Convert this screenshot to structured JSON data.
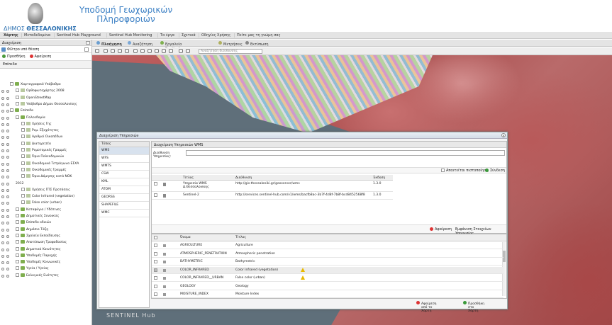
{
  "header": {
    "logo_text_prefix": "ΔΗΜΟΣ ",
    "logo_text_bold": "ΘΕΣΣΑΛΟΝΙΚΗΣ",
    "title_line1": "Υποδομή Γεωχωρικών",
    "title_line2": "Πληροφοριών"
  },
  "menu": [
    "Χάρτης",
    "Μεταδεδομένα",
    "Sentinel Hub Playground",
    "Sentinel Hub Monitoring",
    "Τα έργα",
    "Σχετικά",
    "Οδηγίες Χρήσης",
    "Πείτε μας τη γνώμη σας"
  ],
  "left": {
    "title": "Διαχείριση",
    "search_placeholder": "Φίλτρο υπό θέαση",
    "btn_add": "Προσθήκη",
    "btn_remove": "Αφαίρεση",
    "tab": "Επίπεδα",
    "tree": [
      {
        "label": "Χαρτογραφικό Υπόβαθρο",
        "indent": 1,
        "kind": "folder"
      },
      {
        "label": "Ορθοφωτοχάρτης 2008",
        "indent": 2,
        "kind": "layer"
      },
      {
        "label": "OpenStreetMap",
        "indent": 2,
        "kind": "layer"
      },
      {
        "label": "Υπόβαθρο Δήμου Θεσσαλονίκης",
        "indent": 2,
        "kind": "layer"
      },
      {
        "label": "Επίπεδα",
        "indent": 1,
        "kind": "folder"
      },
      {
        "label": "Πολεοδομία",
        "indent": 2,
        "kind": "folder"
      },
      {
        "label": "Χρήσεις Γης",
        "indent": 3,
        "kind": "layer"
      },
      {
        "label": "Ρυμ. Εξοχότητες",
        "indent": 3,
        "kind": "layer"
      },
      {
        "label": "Αριθμοί Οικοπέδων",
        "indent": 3,
        "kind": "layer"
      },
      {
        "label": "Διατηρητέα",
        "indent": 3,
        "kind": "layer"
      },
      {
        "label": "Ρυμοτομικές Γραμμές",
        "indent": 3,
        "kind": "layer"
      },
      {
        "label": "Όρια Πολεοδομικών",
        "indent": 3,
        "kind": "layer"
      },
      {
        "label": "Οικοδομικά Τετράγωνα ΕΣΧΑ",
        "indent": 3,
        "kind": "layer"
      },
      {
        "label": "Οικοδομικές Γραμμές",
        "indent": 3,
        "kind": "layer"
      },
      {
        "label": "Όρια Δόμησης κατά ΝΟΚ",
        "indent": 3,
        "kind": "layer"
      },
      {
        "label": "2012",
        "indent": 2,
        "kind": "text"
      },
      {
        "label": "Χρήσεις ΓΠΣ Προτάσεις",
        "indent": 3,
        "kind": "layer"
      },
      {
        "label": "Color Infrared (vegetation)",
        "indent": 3,
        "kind": "layer"
      },
      {
        "label": "False color (urban)",
        "indent": 3,
        "kind": "layer"
      },
      {
        "label": "Καταφύγια / Υδάτινες",
        "indent": 2,
        "kind": "folder"
      },
      {
        "label": "Δημοτικές Συνοικίες",
        "indent": 2,
        "kind": "folder"
      },
      {
        "label": "Επίπεδο οδικών",
        "indent": 2,
        "kind": "folder"
      },
      {
        "label": "Δημόσιο Τάξη",
        "indent": 2,
        "kind": "folder"
      },
      {
        "label": "Σχολεία Εκπαίδευσης",
        "indent": 2,
        "kind": "folder"
      },
      {
        "label": "Αποτύπωση Τροφοδοσίας",
        "indent": 2,
        "kind": "folder"
      },
      {
        "label": "Δημοτικά Κοινότητες",
        "indent": 2,
        "kind": "folder"
      },
      {
        "label": "Υποδομές Παροχής",
        "indent": 2,
        "kind": "folder"
      },
      {
        "label": "Υποδομές Κοινωνικές",
        "indent": 2,
        "kind": "folder"
      },
      {
        "label": "Υγεία / Υγείας",
        "indent": 2,
        "kind": "folder"
      },
      {
        "label": "Εκλογικές Ενότητες",
        "indent": 2,
        "kind": "folder"
      }
    ]
  },
  "toolbar": {
    "items": [
      "Πλοήγηση",
      "Αναζήτηση",
      "Εργαλεία Sentinel Hub",
      "Μετρήσεις",
      "Εκτύπωση"
    ],
    "address_placeholder": "Αναζήτηση διεύθυνσης"
  },
  "map": {
    "footer": "SENTINEL Hub"
  },
  "dialog": {
    "title": "Διαχείριση Υπηρεσιών",
    "types_header": "Τύπος",
    "types": [
      "WMS",
      "WFS",
      "WMTS",
      "CSW",
      "KML",
      "ATOM",
      "GEORSS",
      "SHAPEFILE",
      "WMC"
    ],
    "selected_type": "WMS",
    "wms_title": "Διαχείριση Υπηρεσιών WMS",
    "address_label_1": "Διεύθυνση",
    "address_label_2": "Υπηρεσίας:",
    "opt_auth": "Απαιτείται πιστοποίηση",
    "opt_connect": "Σύνδεση",
    "grid_headers": [
      "Τίτλος",
      "Διεύθυνση",
      "Έκδοση"
    ],
    "services": [
      {
        "title": "Υπηρεσία WMS Δ.Θεσσαλονίκης",
        "url": "http://gis.thessaloniki.gr/geoserver/wms",
        "version": "1.3.0"
      },
      {
        "title": "Sentinel-2",
        "url": "http://services.sentinel-hub.com/v1/wms/bacfb8ac-3b7f-4d8f-7b8f-bcd8452568f8",
        "version": "1.3.0"
      }
    ],
    "remove_label": "Αφαίρεση",
    "meta_label": "Εμφάνιση Στοιχείων Υπηρεσίας",
    "layer_headers": [
      "Όνομα",
      "Τίτλος"
    ],
    "layers": [
      {
        "name": "AGRICULTURE",
        "title": "Agriculture",
        "checked": false,
        "warn": false
      },
      {
        "name": "ATMOSPHERIC_PENETRATION",
        "title": "Atmospheric penetration",
        "checked": false,
        "warn": false
      },
      {
        "name": "BATHYMETRIC",
        "title": "Bathymetric",
        "checked": false,
        "warn": false
      },
      {
        "name": "COLOR_INFRARED",
        "title": "Color Infrared (vegetation)",
        "checked": true,
        "warn": true
      },
      {
        "name": "COLOR_INFRARED__URBAN",
        "title": "False color (urban)",
        "checked": false,
        "warn": true
      },
      {
        "name": "GEOLOGY",
        "title": "Geology",
        "checked": false,
        "warn": false
      },
      {
        "name": "MOISTURE_INDEX",
        "title": "Moisture Index",
        "checked": false,
        "warn": false
      }
    ],
    "foot_remove": "Αφαίρεση από το Χάρτη",
    "foot_add": "Προσθήκη στο Χάρτη"
  }
}
